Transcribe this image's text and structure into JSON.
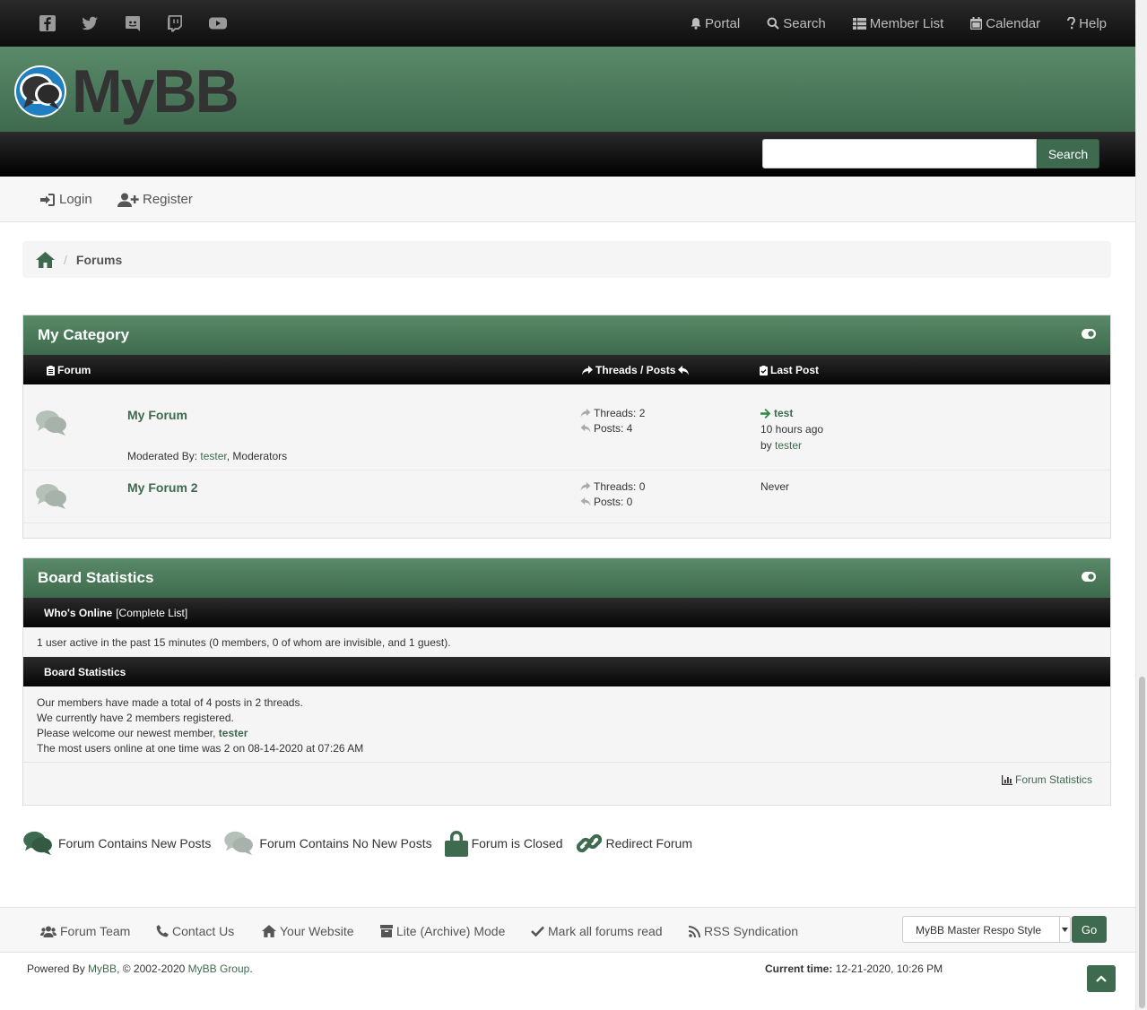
{
  "topnav": {
    "social": [
      "facebook-icon",
      "twitter-icon",
      "discord-icon",
      "twitch-icon",
      "youtube-icon"
    ],
    "items": [
      {
        "label": "Portal",
        "icon": "bell-icon"
      },
      {
        "label": "Search",
        "icon": "search-icon"
      },
      {
        "label": "Member List",
        "icon": "list-icon"
      },
      {
        "label": "Calendar",
        "icon": "calendar-icon"
      },
      {
        "label": "Help",
        "icon": "question-icon"
      }
    ]
  },
  "header": {
    "logo_text": "MyBB"
  },
  "search": {
    "input_value": "",
    "button_label": "Search"
  },
  "userbar": {
    "login": "Login",
    "register": "Register"
  },
  "breadcrumb": {
    "current": "Forums"
  },
  "category": {
    "title": "My Category",
    "columns": {
      "forum": "Forum",
      "threads_posts": "Threads / Posts",
      "last_post": "Last Post"
    },
    "forums": [
      {
        "name": "My Forum",
        "threads": "Threads: 2",
        "posts": "Posts: 4",
        "lastpost_title": "test",
        "lastpost_time": "10 hours ago",
        "lastpost_by": "by",
        "lastpost_user": "tester",
        "moderated_by": "Moderated By:",
        "moderator_user": "tester",
        "moderator_group": ", Moderators"
      },
      {
        "name": "My Forum 2",
        "threads": "Threads: 0",
        "posts": "Posts: 0",
        "lastpost_never": "Never"
      }
    ]
  },
  "stats": {
    "title": "Board Statistics",
    "online_heading": "Who's Online",
    "online_link": "[Complete List]",
    "online_text": "1 user active in the past 15 minutes (0 members, 0 of whom are invisible, and 1 guest).",
    "board_heading": "Board Statistics",
    "line1": "Our members have made a total of 4 posts in 2 threads.",
    "line2": "We currently have 2 members registered.",
    "line3_prefix": "Please welcome our newest member,",
    "line3_user": "tester",
    "line4": "The most users online at one time was 2 on 08-14-2020 at 07:26 AM",
    "forum_statistics_link": "Forum Statistics"
  },
  "legend": {
    "new_posts": "Forum Contains New Posts",
    "no_new_posts": "Forum Contains No New Posts",
    "closed": "Forum is Closed",
    "redirect": "Redirect Forum"
  },
  "footer": {
    "links": [
      "Forum Team",
      "Contact Us",
      "Your Website",
      "Lite (Archive) Mode",
      "Mark all forums read",
      "RSS Syndication"
    ],
    "theme_selected": "MyBB Master Respo Style",
    "go_label": "Go",
    "powered_prefix": "Powered By",
    "powered_mybb": "MyBB",
    "powered_copy": ", © 2002-2020",
    "powered_group": "MyBB Group",
    "powered_end": ".",
    "current_time_label": "Current time:",
    "current_time_value": "12-21-2020, 10:26 PM"
  },
  "colors": {
    "accent": "#3e6a4f",
    "header_green": "#4f7d5e",
    "bar_dark": "#111111"
  }
}
